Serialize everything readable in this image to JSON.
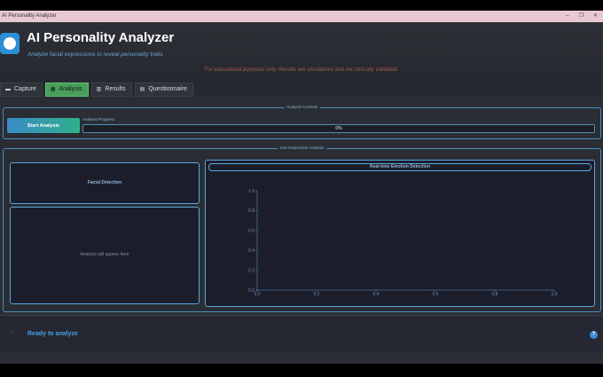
{
  "window": {
    "title": "AI Personality Analyzer",
    "controls": [
      "–",
      "❐",
      "✕"
    ]
  },
  "header": {
    "title": "AI Personality Analyzer",
    "subtitle": "Analyze facial expressions to reveal personality traits",
    "logo_icon": "brain-icon"
  },
  "disclaimer": "For educational purposes only. Results are simulations and not clinically validated.",
  "tabs": [
    {
      "label": "Capture",
      "icon": "camera-icon"
    },
    {
      "label": "Analysis",
      "icon": "analysis-icon",
      "active": true
    },
    {
      "label": "Results",
      "icon": "chart-icon"
    },
    {
      "label": "Questionnaire",
      "icon": "document-icon"
    }
  ],
  "analysis_controls": {
    "title": "Analysis Controls",
    "start_button": "Start Analysis",
    "progress_label": "Analysis Progress",
    "progress_value": 0,
    "progress_text": "0%"
  },
  "live_analysis": {
    "title": "Live Expression Analysis",
    "facial_detection_title": "Facial Detection",
    "analysis_placeholder": "Analysis will appear here",
    "emotion_chart_title": "Real-time Emotion Detection"
  },
  "chart_data": {
    "type": "line",
    "title": "Real-time Emotion Detection",
    "x_ticks": [
      "0.0",
      "0.2",
      "0.4",
      "0.6",
      "0.8",
      "1.0"
    ],
    "y_ticks": [
      "0.0",
      "0.2",
      "0.4",
      "0.6",
      "0.8",
      "1.0"
    ],
    "xlim": [
      0,
      1
    ],
    "ylim": [
      0,
      1
    ],
    "series": [],
    "grid": false
  },
  "status": {
    "text": "Ready to analyze",
    "help_label": "?"
  },
  "colors": {
    "accent": "#4a8fc0",
    "active_tab": "#4a9e5c",
    "button_from": "#3a8bc8",
    "button_to": "#2fb08a",
    "panel_bg": "#1c1d2b"
  }
}
